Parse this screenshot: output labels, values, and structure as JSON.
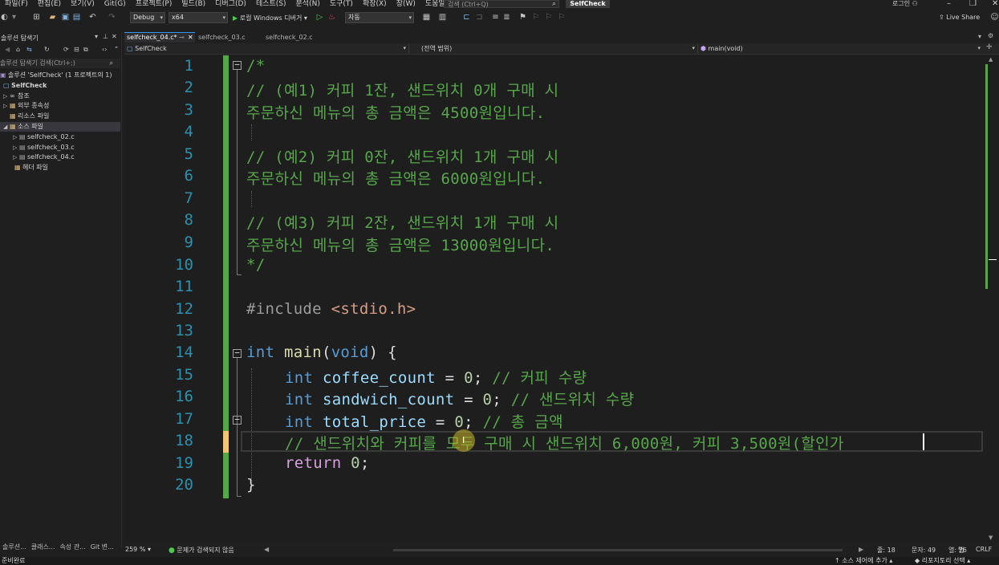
{
  "menu": [
    "파일(F)",
    "편집(E)",
    "보기(V)",
    "Git(G)",
    "프로젝트(P)",
    "빌드(B)",
    "디버그(D)",
    "테스트(S)",
    "분석(N)",
    "도구(T)",
    "확장(X)",
    "창(W)",
    "도움말(H)"
  ],
  "search": {
    "placeholder": "검색 (Ctrl+Q)"
  },
  "solution_name": "SelfCheck",
  "login": "로그인",
  "toolbar": {
    "config": "Debug",
    "platform": "x64",
    "run_label": "로컬 Windows 디버거",
    "auto": "자동",
    "live_share": "Live Share"
  },
  "explorer": {
    "title": "솔루션 탐색기",
    "search_placeholder": "솔루션 탐색기 검색(Ctrl+;)",
    "items": [
      {
        "label": "솔루션 'SelfCheck' (1 프로젝트의 1)"
      },
      {
        "label": "SelfCheck"
      },
      {
        "label": "참조"
      },
      {
        "label": "외부 종속성"
      },
      {
        "label": "리소스 파일"
      },
      {
        "label": "소스 파일"
      },
      {
        "label": "selfcheck_02.c"
      },
      {
        "label": "selfcheck_03.c"
      },
      {
        "label": "selfcheck_04.c"
      },
      {
        "label": "헤더 파일"
      }
    ],
    "bottom_tabs": [
      "솔루션...",
      "클래스...",
      "속성 관...",
      "Git 변..."
    ]
  },
  "tabs": [
    {
      "label": "selfcheck_04.c*"
    },
    {
      "label": "selfcheck_03.c"
    },
    {
      "label": "selfcheck_02.c"
    }
  ],
  "navbar": {
    "project": "SelfCheck",
    "scope": "(전역 범위)",
    "member": "main(void)"
  },
  "code": {
    "line_numbers": [
      "1",
      "2",
      "3",
      "4",
      "5",
      "6",
      "7",
      "8",
      "9",
      "10",
      "11",
      "12",
      "13",
      "14",
      "15",
      "16",
      "17",
      "18",
      "19",
      "20"
    ],
    "l1": "/*",
    "l2": "// (예1) 커피 1잔, 샌드위치 0개 구매 시",
    "l3": "주문하신 메뉴의 총 금액은 4500원입니다.",
    "l5": "// (예2) 커피 0잔, 샌드위치 1개 구매 시",
    "l6": "주문하신 메뉴의 총 금액은 6000원입니다.",
    "l8": "// (예3) 커피 2잔, 샌드위치 1개 구매 시",
    "l9": "주문하신 메뉴의 총 금액은 13000원입니다.",
    "l10": "*/",
    "l12_pp": "#include",
    "l12_inc": "<stdio.h>",
    "l14_kw": "int",
    "l14_fn": "main",
    "l14_p1": "(",
    "l14_kw2": "void",
    "l14_p2": ") {",
    "l15_kw": "int",
    "l15_var": "coffee_count",
    "l15_eq": " = ",
    "l15_num": "0",
    "l15_semi": ";",
    "l15_cmt": " // 커피 수량",
    "l16_kw": "int",
    "l16_var": "sandwich_count",
    "l16_eq": " = ",
    "l16_num": "0",
    "l16_semi": ";",
    "l16_cmt": " // 샌드위치 수량",
    "l17_kw": "int",
    "l17_var": "total_price",
    "l17_eq": " = ",
    "l17_num": "0",
    "l17_semi": ";",
    "l17_cmt": " // 총 금액",
    "l18_cmt": "// 샌드위치와 커피를 모두 구매 시 샌드위치 6,000원, 커피 3,500원(할인가",
    "l19_kw": "return",
    "l19_num": " 0",
    "l19_semi": ";",
    "l20": "}"
  },
  "status": {
    "zoom": "259 %",
    "issues": "문제가 검색되지 않음",
    "line": "줄: 18",
    "char": "문자: 49",
    "col": "열: 76",
    "tab": "탭",
    "eol": "CRLF",
    "ready": "준비완료",
    "add_source": "소스 제어에 추가",
    "select_repo": "리포지토리 선택"
  }
}
